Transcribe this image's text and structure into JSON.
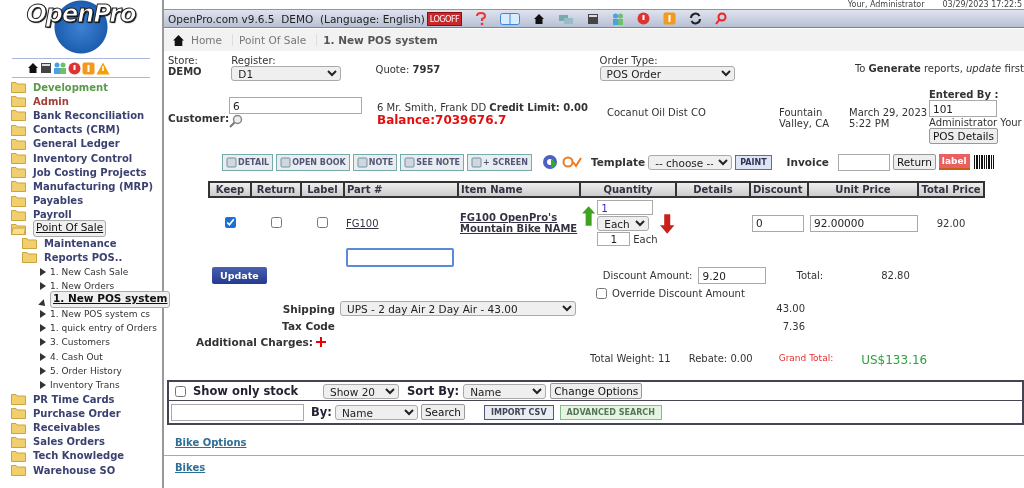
{
  "sidebar": {
    "logo": "OpenPro",
    "items": [
      {
        "label": "Development",
        "color": "#5a9a48",
        "selected": false
      },
      {
        "label": "Admin",
        "color": "#a0403c",
        "selected": false
      },
      {
        "label": "Bank Reconciliation",
        "color": "#3b4170",
        "selected": false
      },
      {
        "label": "Contacts (CRM)",
        "color": "#3b4170",
        "selected": false
      },
      {
        "label": "General Ledger",
        "color": "#3b4170",
        "selected": false
      },
      {
        "label": "Inventory Control",
        "color": "#3b4170",
        "selected": false
      },
      {
        "label": "Job Costing Projects",
        "color": "#3b4170",
        "selected": false
      },
      {
        "label": "Manufacturing (MRP)",
        "color": "#3b4170",
        "selected": false
      },
      {
        "label": "Payables",
        "color": "#3b4170",
        "selected": false
      },
      {
        "label": "Payroll",
        "color": "#3b4170",
        "selected": false
      },
      {
        "label": "Point Of Sale",
        "color": "#111111",
        "selected": true,
        "children": [
          {
            "label": "Maintenance",
            "selected": false
          },
          {
            "label": "Reports POS..",
            "selected": false,
            "children": [
              {
                "label": "1. New Cash Sale",
                "selected": false
              },
              {
                "label": "1. New Orders",
                "selected": false
              },
              {
                "label": "1. New POS system",
                "selected": true
              },
              {
                "label": "1. New POS system cs",
                "selected": false
              },
              {
                "label": "1. quick entry of Orders",
                "selected": false
              },
              {
                "label": "3. Customers",
                "selected": false
              },
              {
                "label": "4. Cash Out",
                "selected": false
              },
              {
                "label": "5. Order History",
                "selected": false
              },
              {
                "label": "Inventory Trans",
                "selected": false
              }
            ]
          }
        ]
      },
      {
        "label": "PR Time Cards",
        "color": "#3b4170",
        "selected": false
      },
      {
        "label": "Purchase Order",
        "color": "#3b4170",
        "selected": false
      },
      {
        "label": "Receivables",
        "color": "#3b4170",
        "selected": false
      },
      {
        "label": "Sales Orders",
        "color": "#3b4170",
        "selected": false
      },
      {
        "label": "Tech Knowledge",
        "color": "#3b4170",
        "selected": false
      },
      {
        "label": "Warehouse SO",
        "color": "#3b4170",
        "selected": false
      }
    ]
  },
  "user_info": {
    "name": "Your, Administrator",
    "time": "03/29/2023 17:22:5"
  },
  "header": {
    "title": "OpenPro.com v9.6.5  DEMO  (Language: English)",
    "logoff": "LOGOFF"
  },
  "breadcrumb": [
    "Home",
    "Point Of Sale",
    "1. New POS system"
  ],
  "form": {
    "store_label": "Store:",
    "store": "DEMO",
    "register_label": "Register:",
    "register": "D1",
    "quote_label": "Quote:",
    "quote": "7957",
    "order_type_label": "Order Type:",
    "order_type": "POS Order",
    "note": "To **Generate** reports, *update* first",
    "customer_label": "Customer:",
    "customer": "6",
    "customer_info": "6 Mr. Smith, Frank DD **Credit Limit: 0.00**",
    "balance": "Balance:7039676.7",
    "company": "Cocanut Oil Dist CO",
    "city": "Fountain Valley, CA",
    "date": "March 29, 2023 5:22 PM",
    "entered_by_label": "Entered By :",
    "entered_by": "101",
    "entered_by_name": "Administrator Your",
    "pos_details": "POS Details"
  },
  "toolbar": {
    "buttons": [
      "DETAIL",
      "OPEN BOOK",
      "NOTE",
      "SEE NOTE",
      "+ SCREEN"
    ],
    "template_label": "Template",
    "template": "-- choose --",
    "paint": "PAINT",
    "invoice_label": "Invoice",
    "return": "Return",
    "label": "label"
  },
  "table": {
    "columns": [
      "Keep",
      "Return",
      "Label",
      "Part #",
      "Item Name",
      "Quantity",
      "Details",
      "Discount",
      "Unit Price",
      "Total Price"
    ],
    "rows": [
      {
        "keep": true,
        "return": false,
        "label": false,
        "part": "FG100",
        "item": "FG100 OpenPro's Mountain Bike NAME",
        "quantity": "1",
        "unit": "Each",
        "conversion": "1",
        "conversion_unit": "Each",
        "discount": "0",
        "unit_price": "92.00000",
        "total": "92.00"
      }
    ]
  },
  "update": "Update",
  "totals": {
    "discount_label": "Discount Amount:",
    "discount": "9.20",
    "total_label": "Total:",
    "total": "82.80",
    "override": false,
    "override_label": "Override Discount Amount",
    "shipping_label": "Shipping",
    "shipping": "UPS - 2 day Air 2 Day Air - 43.00",
    "shipping_amount": "43.00",
    "tax_label": "Tax Code",
    "tax": "7.36",
    "additional_label": "Additional Charges:",
    "weight": "Total Weight: 11",
    "rebate": "Rebate: 0.00",
    "grand_label": "Grand Total:",
    "grand": "US$133.16"
  },
  "search": {
    "stock_only": false,
    "stock_label": "Show only stock",
    "show": "Show 20",
    "sort_label": "Sort By:",
    "sort": "Name",
    "change": "Change Options",
    "by_label": "By:",
    "by": "Name",
    "search": "Search",
    "import": "IMPORT CSV",
    "advanced": "ADVANCED SEARCH"
  },
  "categories": [
    "Bike Options",
    "Bikes"
  ]
}
